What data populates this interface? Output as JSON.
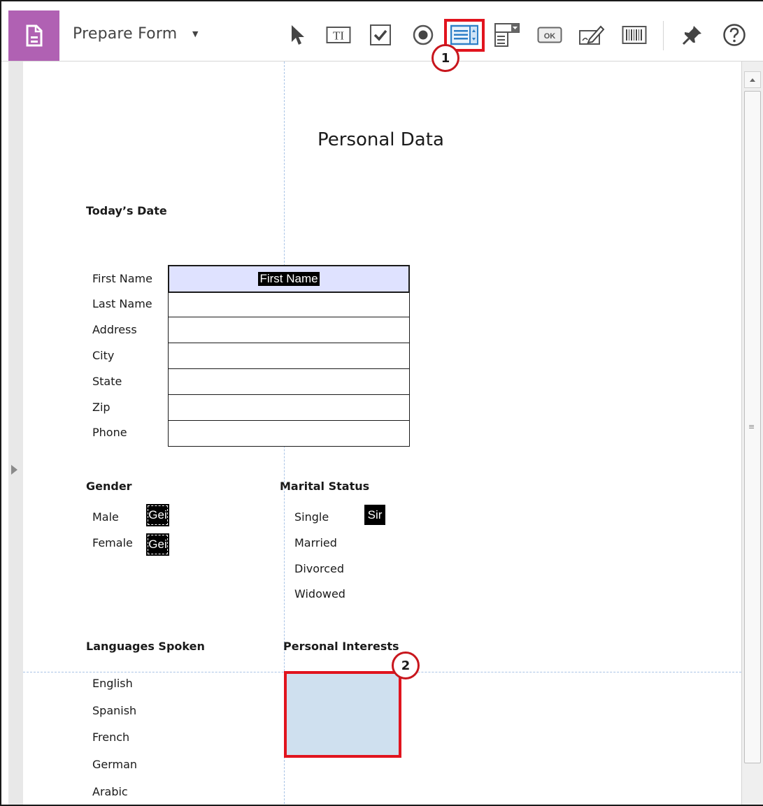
{
  "toolbar": {
    "title": "Prepare Form",
    "tools": [
      {
        "icon": "select-object-icon"
      },
      {
        "icon": "text-field-icon",
        "label": "TI"
      },
      {
        "icon": "checkbox-icon"
      },
      {
        "icon": "radio-button-icon"
      },
      {
        "icon": "list-box-icon",
        "highlighted": true
      },
      {
        "icon": "dropdown-icon"
      },
      {
        "icon": "button-icon",
        "label": "OK"
      },
      {
        "icon": "digital-signature-icon"
      },
      {
        "icon": "barcode-icon"
      },
      {
        "icon": "pin-icon"
      },
      {
        "icon": "help-icon"
      }
    ]
  },
  "callouts": {
    "one": "1",
    "two": "2"
  },
  "form": {
    "title": "Personal Data",
    "todays_date": "Today’s Date",
    "labels": [
      "First Name",
      "Last Name",
      "Address",
      "City",
      "State",
      "Zip",
      "Phone"
    ],
    "first_name_field": "First Name",
    "gender": {
      "heading": "Gender",
      "options": [
        "Male",
        "Female"
      ],
      "field_tag": "Gei"
    },
    "marital": {
      "heading": "Marital Status",
      "options": [
        "Single",
        "Married",
        "Divorced",
        "Widowed"
      ],
      "field_tag": "Sir"
    },
    "languages": {
      "heading": "Languages Spoken",
      "options": [
        "English",
        "Spanish",
        "French",
        "German",
        "Arabic"
      ]
    },
    "interests": {
      "heading": "Personal Interests"
    }
  },
  "colors": {
    "app_tile": "#b061b3",
    "highlight": "#e1141e",
    "selected_field": "#dfe2ff",
    "listbox_field": "#cfe0ef",
    "guide": "#a9c4e6"
  }
}
